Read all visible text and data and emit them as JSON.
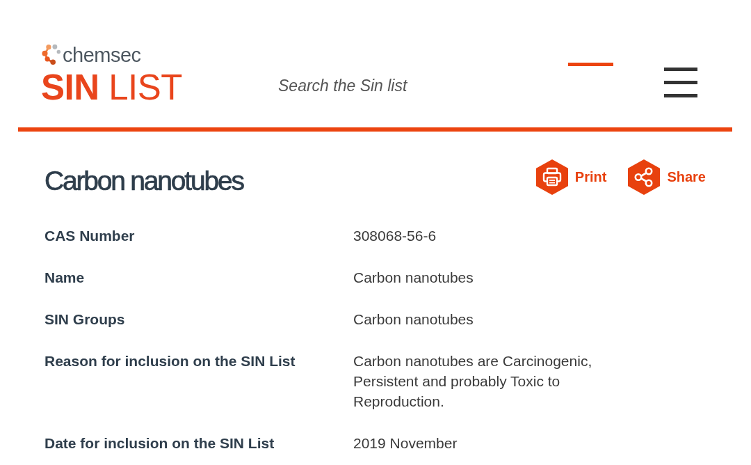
{
  "header": {
    "logo": {
      "brand": "chemsec",
      "title": "**SIN** LIST"
    },
    "search": {
      "placeholder": "Search the Sin list"
    }
  },
  "article": {
    "title": "Carbon nanotubes",
    "actions": [
      {
        "kind": "print",
        "label": "Print"
      },
      {
        "kind": "share",
        "label": "Share"
      }
    ],
    "details": [
      {
        "label": "CAS Number",
        "value": "308068-56-6"
      },
      {
        "label": "Name",
        "value": "Carbon nanotubes"
      },
      {
        "label": "SIN Groups",
        "value": "Carbon nanotubes"
      },
      {
        "label": "Reason for inclusion on the SIN List",
        "value": "Carbon nanotubes are Carcinogenic, Persistent and probably Toxic to Reproduction."
      },
      {
        "label": "Date for inclusion on the SIN List",
        "value": "2019 November"
      }
    ]
  }
}
